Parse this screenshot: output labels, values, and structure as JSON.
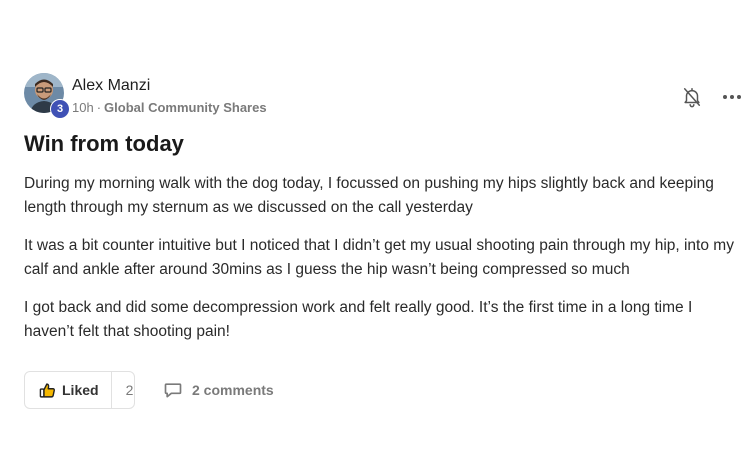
{
  "post": {
    "author": {
      "name": "Alex Manzi",
      "level": "3"
    },
    "meta": {
      "time": "10h",
      "separator": "·",
      "category": "Global Community Shares"
    },
    "title": "Win from today",
    "body": [
      "During my morning walk with the dog today, I focussed on pushing my hips slightly back and keeping length through my sternum as we discussed on the call yesterday",
      "It was a bit counter intuitive but I noticed that I didn’t get my usual shooting pain through my hip, into my calf and ankle after around 30mins as I guess the hip wasn’t being compressed so much",
      "I got back and did some decompression work and felt really good. It’s the first time in a long time I haven’t felt that shooting pain!"
    ],
    "actions": {
      "like_label": "Liked",
      "like_count": "2",
      "comments_label": "2 comments"
    }
  },
  "icons": {
    "bell": "bell-muted-icon",
    "more": "more-dots-icon",
    "like": "thumbs-up-icon",
    "comment": "comment-bubble-icon"
  },
  "colors": {
    "badge": "#3f51b5",
    "muted_text": "#7a7a7a",
    "border": "#e1e1e1"
  }
}
